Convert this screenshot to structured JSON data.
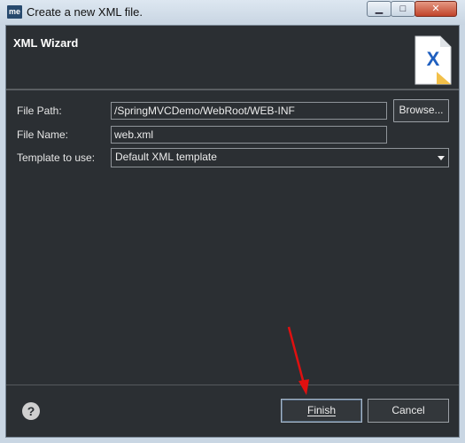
{
  "window": {
    "app_icon_text": "me",
    "title": "Create a new XML file.",
    "controls": [
      "minimize",
      "maximize",
      "close"
    ]
  },
  "header": {
    "title": "XML Wizard",
    "icon": "xml-file-icon",
    "icon_letter": "X"
  },
  "form": {
    "file_path_label": "File Path:",
    "file_path_value": "/SpringMVCDemo/WebRoot/WEB-INF",
    "browse_label": "Browse...",
    "file_name_label": "File Name:",
    "file_name_value": "web.xml",
    "template_label": "Template to use:",
    "template_value": "Default XML template"
  },
  "footer": {
    "help_symbol": "?",
    "finish_label": "Finish",
    "cancel_label": "Cancel"
  },
  "colors": {
    "background": "#2b2f33",
    "text": "#e6e6e6",
    "annotation_arrow": "#e01010"
  }
}
